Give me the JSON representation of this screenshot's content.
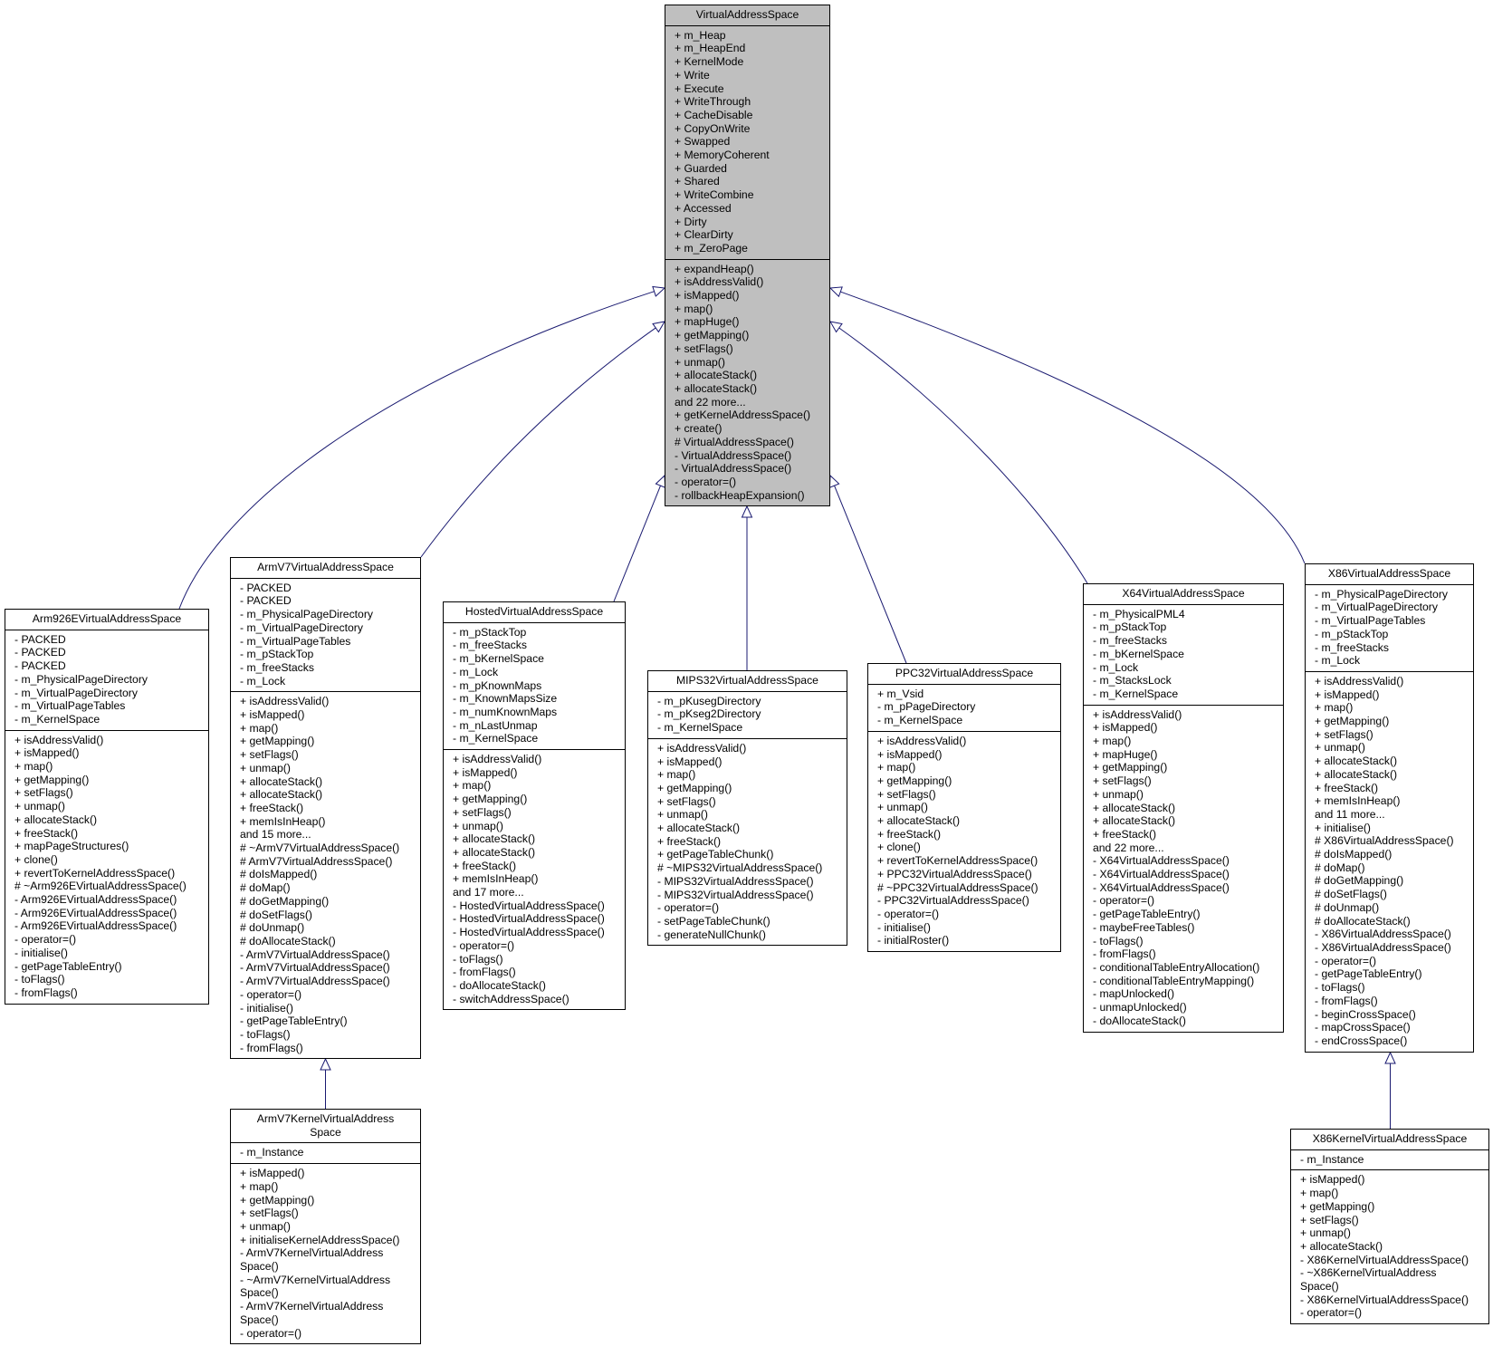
{
  "diagram": {
    "type": "class-inheritance-graph",
    "edge_color": "#191970",
    "base_fill": "#bfbfbf",
    "classes": [
      {
        "id": "VirtualAddressSpace",
        "title": "VirtualAddressSpace",
        "is_base": true,
        "attributes": [
          "+ m_Heap",
          "+ m_HeapEnd",
          "+ KernelMode",
          "+ Write",
          "+ Execute",
          "+ WriteThrough",
          "+ CacheDisable",
          "+ CopyOnWrite",
          "+ Swapped",
          "+ MemoryCoherent",
          "+ Guarded",
          "+ Shared",
          "+ WriteCombine",
          "+ Accessed",
          "+ Dirty",
          "+ ClearDirty",
          "+ m_ZeroPage"
        ],
        "methods": [
          "+ expandHeap()",
          "+ isAddressValid()",
          "+ isMapped()",
          "+ map()",
          "+ mapHuge()",
          "+ getMapping()",
          "+ setFlags()",
          "+ unmap()",
          "+ allocateStack()",
          "+ allocateStack()",
          "and 22 more...",
          "+ getKernelAddressSpace()",
          "+ create()",
          "# VirtualAddressSpace()",
          "- VirtualAddressSpace()",
          "- VirtualAddressSpace()",
          "- operator=()",
          "- rollbackHeapExpansion()"
        ]
      },
      {
        "id": "Arm926EVirtualAddressSpace",
        "title": "Arm926EVirtualAddressSpace",
        "parent": "VirtualAddressSpace",
        "attributes": [
          "- PACKED",
          "- PACKED",
          "- PACKED",
          "- m_PhysicalPageDirectory",
          "- m_VirtualPageDirectory",
          "- m_VirtualPageTables",
          "- m_KernelSpace"
        ],
        "methods": [
          "+ isAddressValid()",
          "+ isMapped()",
          "+ map()",
          "+ getMapping()",
          "+ setFlags()",
          "+ unmap()",
          "+ allocateStack()",
          "+ freeStack()",
          "+ mapPageStructures()",
          "+ clone()",
          "+ revertToKernelAddressSpace()",
          "# ~Arm926EVirtualAddressSpace()",
          "- Arm926EVirtualAddressSpace()",
          "- Arm926EVirtualAddressSpace()",
          "- Arm926EVirtualAddressSpace()",
          "- operator=()",
          "- initialise()",
          "- getPageTableEntry()",
          "- toFlags()",
          "- fromFlags()"
        ]
      },
      {
        "id": "ArmV7VirtualAddressSpace",
        "title": "ArmV7VirtualAddressSpace",
        "parent": "VirtualAddressSpace",
        "attributes": [
          "- PACKED",
          "- PACKED",
          "- m_PhysicalPageDirectory",
          "- m_VirtualPageDirectory",
          "- m_VirtualPageTables",
          "- m_pStackTop",
          "- m_freeStacks",
          "- m_Lock"
        ],
        "methods": [
          "+ isAddressValid()",
          "+ isMapped()",
          "+ map()",
          "+ getMapping()",
          "+ setFlags()",
          "+ unmap()",
          "+ allocateStack()",
          "+ allocateStack()",
          "+ freeStack()",
          "+ memIsInHeap()",
          "and 15 more...",
          "# ~ArmV7VirtualAddressSpace()",
          "# ArmV7VirtualAddressSpace()",
          "# doIsMapped()",
          "# doMap()",
          "# doGetMapping()",
          "# doSetFlags()",
          "# doUnmap()",
          "# doAllocateStack()",
          "- ArmV7VirtualAddressSpace()",
          "- ArmV7VirtualAddressSpace()",
          "- ArmV7VirtualAddressSpace()",
          "- operator=()",
          "- initialise()",
          "- getPageTableEntry()",
          "- toFlags()",
          "- fromFlags()"
        ]
      },
      {
        "id": "ArmV7KernelVirtualAddressSpace",
        "title": "ArmV7KernelVirtualAddress\nSpace",
        "parent": "ArmV7VirtualAddressSpace",
        "attributes": [
          "- m_Instance"
        ],
        "methods": [
          "+ isMapped()",
          "+ map()",
          "+ getMapping()",
          "+ setFlags()",
          "+ unmap()",
          "+ initialiseKernelAddressSpace()",
          "- ArmV7KernelVirtualAddress\nSpace()",
          "- ~ArmV7KernelVirtualAddress\nSpace()",
          "- ArmV7KernelVirtualAddress\nSpace()",
          "- operator=()"
        ]
      },
      {
        "id": "HostedVirtualAddressSpace",
        "title": "HostedVirtualAddressSpace",
        "parent": "VirtualAddressSpace",
        "attributes": [
          "- m_pStackTop",
          "- m_freeStacks",
          "- m_bKernelSpace",
          "- m_Lock",
          "- m_pKnownMaps",
          "- m_KnownMapsSize",
          "- m_numKnownMaps",
          "- m_nLastUnmap",
          "- m_KernelSpace"
        ],
        "methods": [
          "+ isAddressValid()",
          "+ isMapped()",
          "+ map()",
          "+ getMapping()",
          "+ setFlags()",
          "+ unmap()",
          "+ allocateStack()",
          "+ allocateStack()",
          "+ freeStack()",
          "+ memIsInHeap()",
          "and 17 more...",
          "- HostedVirtualAddressSpace()",
          "- HostedVirtualAddressSpace()",
          "- HostedVirtualAddressSpace()",
          "- operator=()",
          "- toFlags()",
          "- fromFlags()",
          "- doAllocateStack()",
          "- switchAddressSpace()"
        ]
      },
      {
        "id": "MIPS32VirtualAddressSpace",
        "title": "MIPS32VirtualAddressSpace",
        "parent": "VirtualAddressSpace",
        "attributes": [
          "- m_pKusegDirectory",
          "- m_pKseg2Directory",
          "- m_KernelSpace"
        ],
        "methods": [
          "+ isAddressValid()",
          "+ isMapped()",
          "+ map()",
          "+ getMapping()",
          "+ setFlags()",
          "+ unmap()",
          "+ allocateStack()",
          "+ freeStack()",
          "+ getPageTableChunk()",
          "# ~MIPS32VirtualAddressSpace()",
          "- MIPS32VirtualAddressSpace()",
          "- MIPS32VirtualAddressSpace()",
          "- operator=()",
          "- setPageTableChunk()",
          "- generateNullChunk()"
        ]
      },
      {
        "id": "PPC32VirtualAddressSpace",
        "title": "PPC32VirtualAddressSpace",
        "parent": "VirtualAddressSpace",
        "attributes": [
          "+ m_Vsid",
          "- m_pPageDirectory",
          "- m_KernelSpace"
        ],
        "methods": [
          "+ isAddressValid()",
          "+ isMapped()",
          "+ map()",
          "+ getMapping()",
          "+ setFlags()",
          "+ unmap()",
          "+ allocateStack()",
          "+ freeStack()",
          "+ clone()",
          "+ revertToKernelAddressSpace()",
          "+ PPC32VirtualAddressSpace()",
          "# ~PPC32VirtualAddressSpace()",
          "- PPC32VirtualAddressSpace()",
          "- operator=()",
          "- initialise()",
          "- initialRoster()"
        ]
      },
      {
        "id": "X64VirtualAddressSpace",
        "title": "X64VirtualAddressSpace",
        "parent": "VirtualAddressSpace",
        "attributes": [
          "- m_PhysicalPML4",
          "- m_pStackTop",
          "- m_freeStacks",
          "- m_bKernelSpace",
          "- m_Lock",
          "- m_StacksLock",
          "- m_KernelSpace"
        ],
        "methods": [
          "+ isAddressValid()",
          "+ isMapped()",
          "+ map()",
          "+ mapHuge()",
          "+ getMapping()",
          "+ setFlags()",
          "+ unmap()",
          "+ allocateStack()",
          "+ allocateStack()",
          "+ freeStack()",
          "and 22 more...",
          "- X64VirtualAddressSpace()",
          "- X64VirtualAddressSpace()",
          "- X64VirtualAddressSpace()",
          "- operator=()",
          "- getPageTableEntry()",
          "- maybeFreeTables()",
          "- toFlags()",
          "- fromFlags()",
          "- conditionalTableEntryAllocation()",
          "- conditionalTableEntryMapping()",
          "- mapUnlocked()",
          "- unmapUnlocked()",
          "- doAllocateStack()"
        ]
      },
      {
        "id": "X86VirtualAddressSpace",
        "title": "X86VirtualAddressSpace",
        "parent": "VirtualAddressSpace",
        "attributes": [
          "- m_PhysicalPageDirectory",
          "- m_VirtualPageDirectory",
          "- m_VirtualPageTables",
          "- m_pStackTop",
          "- m_freeStacks",
          "- m_Lock"
        ],
        "methods": [
          "+ isAddressValid()",
          "+ isMapped()",
          "+ map()",
          "+ getMapping()",
          "+ setFlags()",
          "+ unmap()",
          "+ allocateStack()",
          "+ allocateStack()",
          "+ freeStack()",
          "+ memIsInHeap()",
          "and 11 more...",
          "+ initialise()",
          "# X86VirtualAddressSpace()",
          "# doIsMapped()",
          "# doMap()",
          "# doGetMapping()",
          "# doSetFlags()",
          "# doUnmap()",
          "# doAllocateStack()",
          "- X86VirtualAddressSpace()",
          "- X86VirtualAddressSpace()",
          "- operator=()",
          "- getPageTableEntry()",
          "- toFlags()",
          "- fromFlags()",
          "- beginCrossSpace()",
          "- mapCrossSpace()",
          "- endCrossSpace()"
        ]
      },
      {
        "id": "X86KernelVirtualAddressSpace",
        "title": "X86KernelVirtualAddressSpace",
        "parent": "X86VirtualAddressSpace",
        "attributes": [
          "- m_Instance"
        ],
        "methods": [
          "+ isMapped()",
          "+ map()",
          "+ getMapping()",
          "+ setFlags()",
          "+ unmap()",
          "+ allocateStack()",
          "- X86KernelVirtualAddressSpace()",
          "- ~X86KernelVirtualAddress\nSpace()",
          "- X86KernelVirtualAddressSpace()",
          "- operator=()"
        ]
      }
    ]
  }
}
